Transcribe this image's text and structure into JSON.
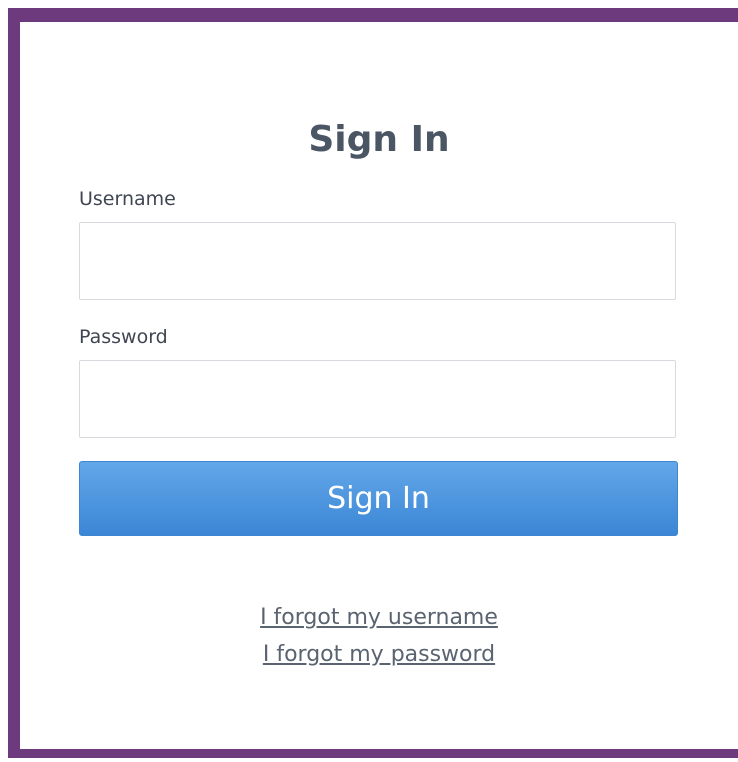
{
  "title": "Sign In",
  "form": {
    "username_label": "Username",
    "username_value": "",
    "password_label": "Password",
    "password_value": "",
    "submit_label": "Sign In"
  },
  "links": {
    "forgot_username": "I forgot my username",
    "forgot_password": "I forgot my password"
  },
  "colors": {
    "frame": "#6d3b7d",
    "button_top": "#63a7e8",
    "button_bottom": "#3b86d6",
    "title_text": "#4b5665",
    "link_text": "#5a6470"
  }
}
